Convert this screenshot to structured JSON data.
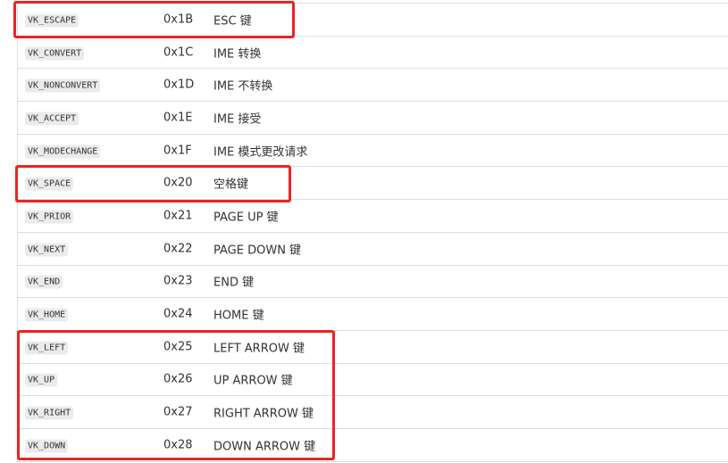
{
  "rows": [
    {
      "constant": "VK_ESCAPE",
      "value": "0x1B",
      "description": "ESC 键"
    },
    {
      "constant": "VK_CONVERT",
      "value": "0x1C",
      "description": "IME 转换"
    },
    {
      "constant": "VK_NONCONVERT",
      "value": "0x1D",
      "description": "IME 不转换"
    },
    {
      "constant": "VK_ACCEPT",
      "value": "0x1E",
      "description": "IME 接受"
    },
    {
      "constant": "VK_MODECHANGE",
      "value": "0x1F",
      "description": "IME 模式更改请求"
    },
    {
      "constant": "VK_SPACE",
      "value": "0x20",
      "description": "空格键"
    },
    {
      "constant": "VK_PRIOR",
      "value": "0x21",
      "description": "PAGE UP 键"
    },
    {
      "constant": "VK_NEXT",
      "value": "0x22",
      "description": "PAGE DOWN 键"
    },
    {
      "constant": "VK_END",
      "value": "0x23",
      "description": "END 键"
    },
    {
      "constant": "VK_HOME",
      "value": "0x24",
      "description": "HOME 键"
    },
    {
      "constant": "VK_LEFT",
      "value": "0x25",
      "description": "LEFT ARROW 键"
    },
    {
      "constant": "VK_UP",
      "value": "0x26",
      "description": "UP ARROW 键"
    },
    {
      "constant": "VK_RIGHT",
      "value": "0x27",
      "description": "RIGHT ARROW 键"
    },
    {
      "constant": "VK_DOWN",
      "value": "0x28",
      "description": "DOWN ARROW 键"
    }
  ],
  "highlight_color": "#ee2222"
}
